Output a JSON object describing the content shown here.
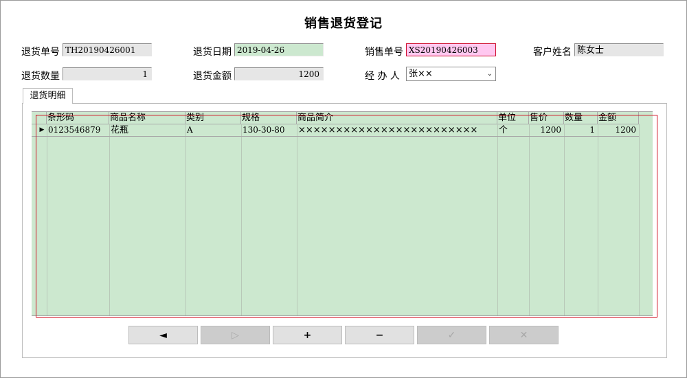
{
  "title": "销售退货登记",
  "form": {
    "return_no_label": "退货单号",
    "return_no": "TH20190426001",
    "return_date_label": "退货日期",
    "return_date": "2019-04-26",
    "sales_no_label": "销售单号",
    "sales_no": "XS20190426003",
    "customer_label": "客户姓名",
    "customer": "陈女士",
    "return_qty_label": "退货数量",
    "return_qty": "1",
    "return_amount_label": "退货金额",
    "return_amount": "1200",
    "handler_label": "经 办 人",
    "handler": "张××"
  },
  "tab_label": "退货明细",
  "grid": {
    "columns": [
      "条形码",
      "商品名称",
      "类别",
      "规格",
      "商品简介",
      "单位",
      "售价",
      "数量",
      "金额"
    ],
    "rows": [
      [
        "0123546879",
        "花瓶",
        "A",
        "130-30-80",
        "××××××××××××××××××××××××",
        "个",
        "1200",
        "1",
        "1200"
      ]
    ]
  },
  "buttons": {
    "prev": "◄",
    "next": "▷",
    "add": "+",
    "delete": "−",
    "confirm": "✓",
    "cancel": "✕"
  },
  "colors": {
    "grid_bg": "#cce8cf",
    "sales_no_bg": "#ffc8f0",
    "highlight_border": "#d01020"
  }
}
